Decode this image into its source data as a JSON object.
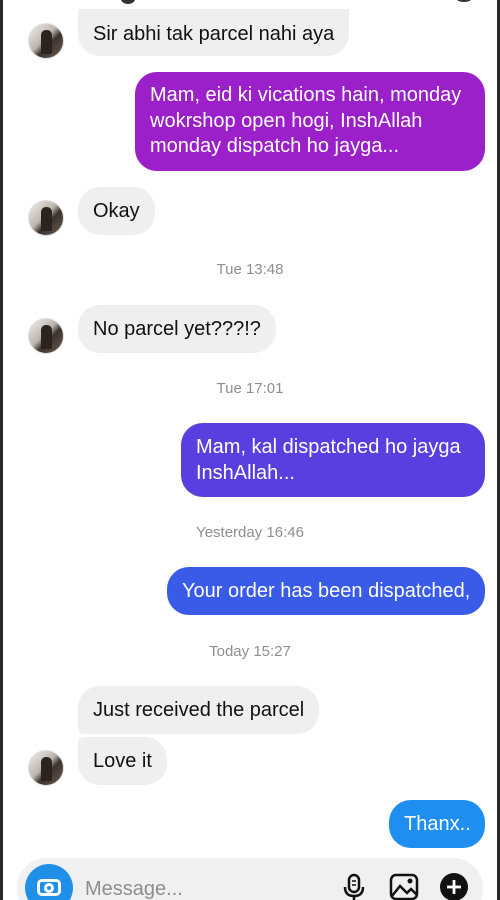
{
  "messages": {
    "m1": "Sir abhi tak parcel nahi aya",
    "m2": [
      "Mam, eid ki vications hain, monday",
      "wokrshop open hogi, InshAllah",
      "monday dispatch ho jayga..."
    ],
    "m3": "Okay",
    "ts1": "Tue 13:48",
    "m4": "No parcel yet???!?",
    "ts2": "Tue 17:01",
    "m5": [
      "Mam, kal dispatched ho jayga",
      "InshAllah..."
    ],
    "ts3": "Yesterday 16:46",
    "m6": "Your order has been dispatched,",
    "ts4": "Today 15:27",
    "m7": "Just received the parcel",
    "m8": "Love it",
    "m9": "Thanx.."
  },
  "composer": {
    "placeholder": "Message..."
  },
  "icons": {
    "camera": "camera-icon",
    "mic": "microphone-icon",
    "gallery": "image-icon",
    "add": "plus-circle-icon"
  },
  "colors": {
    "outgoing_purple": "#9b20c9",
    "outgoing_indigo": "#5a3fe0",
    "outgoing_blue": "#3a5ae8",
    "outgoing_lightblue": "#1e8ff0",
    "incoming": "#efefef",
    "camera_button": "#1f8fe8"
  }
}
